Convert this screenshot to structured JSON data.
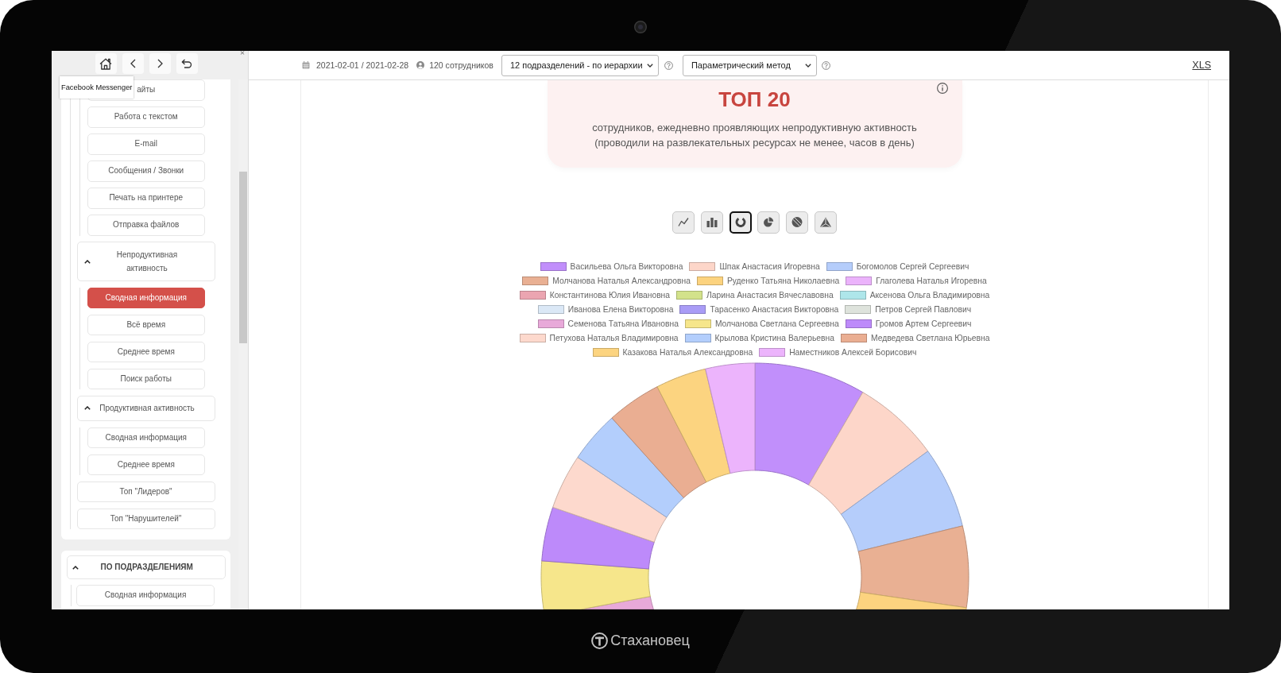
{
  "device": {
    "brand": "Стахановец"
  },
  "sidebar": {
    "tooltip": "Facebook Messenger",
    "sections": [
      {
        "items": [
          {
            "children": [
              {
                "label": "айты",
                "selected": false
              },
              {
                "label": "Работа с текстом",
                "selected": false
              },
              {
                "label": "E-mail",
                "selected": false
              },
              {
                "label": "Сообщения / Звонки",
                "selected": false
              },
              {
                "label": "Печать на принтере",
                "selected": false
              },
              {
                "label": "Отправка файлов",
                "selected": false
              }
            ]
          },
          {
            "label": "Непродуктивная активность",
            "expanded": true,
            "children": [
              {
                "label": "Сводная информация",
                "selected": true
              },
              {
                "label": "Всё время",
                "selected": false
              },
              {
                "label": "Среднее время",
                "selected": false
              },
              {
                "label": "Поиск работы",
                "selected": false
              }
            ]
          },
          {
            "label": "Продуктивная активность",
            "expanded": true,
            "children": [
              {
                "label": "Сводная информация",
                "selected": false
              },
              {
                "label": "Среднее время",
                "selected": false
              }
            ]
          },
          {
            "label": "Топ \"Лидеров\"",
            "selected": false
          },
          {
            "label": "Топ \"Нарушителей\"",
            "selected": false
          }
        ]
      },
      {
        "title": "ПО ПОДРАЗДЕЛЕНИЯМ",
        "expanded": true,
        "items": [
          {
            "label": "Сводная информация",
            "selected": false
          }
        ]
      }
    ]
  },
  "toolbar": {
    "period": "2021-02-01 / 2021-02-28",
    "employees": "120 сотрудников",
    "department_select": "12 подразделений - по иерархии",
    "method_select": "Параметрический метод",
    "export_link": "XLS"
  },
  "report": {
    "title": "ТОП 20",
    "subtitle": "сотрудников, ежедневно проявляющих непродуктивную активность",
    "note": "(проводили на развлекательных ресурсах не менее, часов в день)",
    "chart_types": [
      {
        "kind": "line",
        "selected": false
      },
      {
        "kind": "bar",
        "selected": false
      },
      {
        "kind": "donut",
        "selected": true
      },
      {
        "kind": "pie",
        "selected": false
      },
      {
        "kind": "polar",
        "selected": false
      },
      {
        "kind": "radar",
        "selected": false
      }
    ],
    "legend": [
      {
        "name": "Васильева Ольга Викторовна",
        "color": "#c18ffb"
      },
      {
        "name": "Шпак Анастасия Игоревна",
        "color": "#fdd6c9"
      },
      {
        "name": "Богомолов Сергей Сергеевич",
        "color": "#b5cdfb"
      },
      {
        "name": "Молчанова Наталья Александровна",
        "color": "#e9b093"
      },
      {
        "name": "Руденко Татьяна Николаевна",
        "color": "#fcd37f"
      },
      {
        "name": "Глаголева Наталья Игоревна",
        "color": "#ebb3fb"
      },
      {
        "name": "Константинова Юлия Ивановна",
        "color": "#eba5b1"
      },
      {
        "name": "Ларина Анастасия Вячеславовна",
        "color": "#d3e28b"
      },
      {
        "name": "Аксенова Ольга Владимировна",
        "color": "#aee6ea"
      },
      {
        "name": "Иванова Елена Викторовна",
        "color": "#dbe8f6"
      },
      {
        "name": "Тарасенко Анастасия Викторовна",
        "color": "#a99cf6"
      },
      {
        "name": "Петров Сергей Павлович",
        "color": "#dee3dc"
      },
      {
        "name": "Семенова Татьяна Ивановна",
        "color": "#e8a9d9"
      },
      {
        "name": "Молчанова Светлана Сергеевна",
        "color": "#f6e68b"
      },
      {
        "name": "Громов Артем Сергеевич",
        "color": "#bd8afa"
      },
      {
        "name": "Петухова Наталья Владимировна",
        "color": "#fdd9cd"
      },
      {
        "name": "Крылова Кристина Валерьевна",
        "color": "#b3cefc"
      },
      {
        "name": "Медведева Светлана Юрьевна",
        "color": "#eaae92"
      },
      {
        "name": "Казакова Наталья Александровна",
        "color": "#fcd480"
      },
      {
        "name": "Наместников Алексей Борисович",
        "color": "#ecb4fc"
      }
    ]
  }
}
